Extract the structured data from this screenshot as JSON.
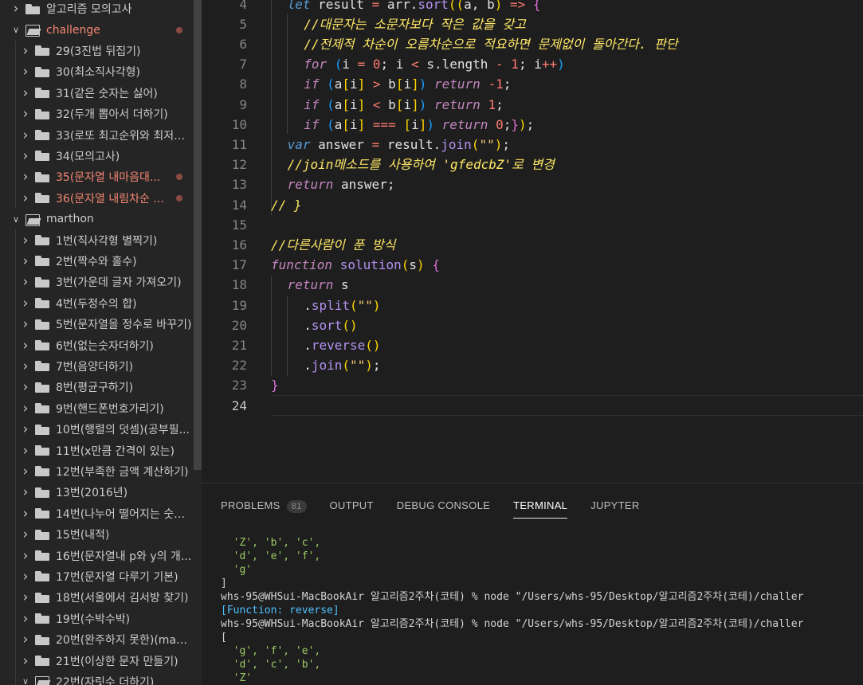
{
  "sidebar": {
    "rows": [
      {
        "label": "알고리즘 모의고사",
        "open": false,
        "depth": 0,
        "modified": false
      },
      {
        "label": "challenge",
        "open": true,
        "depth": 0,
        "modified": true
      },
      {
        "label": "29(3진법 뒤집기)",
        "open": false,
        "depth": 1,
        "modified": false
      },
      {
        "label": "30(최소직사각형)",
        "open": false,
        "depth": 1,
        "modified": false
      },
      {
        "label": "31(같은 숫자는 싫어)",
        "open": false,
        "depth": 1,
        "modified": false
      },
      {
        "label": "32(두개 뽑아서 더하기)",
        "open": false,
        "depth": 1,
        "modified": false
      },
      {
        "label": "33(로또 최고순위와 최저순...",
        "open": false,
        "depth": 1,
        "modified": false
      },
      {
        "label": "34(모의고사)",
        "open": false,
        "depth": 1,
        "modified": false
      },
      {
        "label": "35(문자열 내마음대...",
        "open": false,
        "depth": 1,
        "modified": true
      },
      {
        "label": "36(문자열 내림차순 ...",
        "open": false,
        "depth": 1,
        "modified": true
      },
      {
        "label": "marthon",
        "open": true,
        "depth": 0,
        "modified": false
      },
      {
        "label": "1번(직사각형 별찍기)",
        "open": false,
        "depth": 1,
        "modified": false
      },
      {
        "label": "2번(짝수와 홀수)",
        "open": false,
        "depth": 1,
        "modified": false
      },
      {
        "label": "3번(가운데 글자 가져오기)",
        "open": false,
        "depth": 1,
        "modified": false
      },
      {
        "label": "4번(두정수의 합)",
        "open": false,
        "depth": 1,
        "modified": false
      },
      {
        "label": "5번(문자열을 정수로 바꾸기)",
        "open": false,
        "depth": 1,
        "modified": false
      },
      {
        "label": "6번(없는숫자더하기)",
        "open": false,
        "depth": 1,
        "modified": false
      },
      {
        "label": "7번(음양더하기)",
        "open": false,
        "depth": 1,
        "modified": false
      },
      {
        "label": "8번(평균구하기)",
        "open": false,
        "depth": 1,
        "modified": false
      },
      {
        "label": "9번(핸드폰번호가리기)",
        "open": false,
        "depth": 1,
        "modified": false
      },
      {
        "label": "10번(행렬의 덧셈)(공부필...",
        "open": false,
        "depth": 1,
        "modified": false
      },
      {
        "label": "11번(x만큼 간격이 있는)",
        "open": false,
        "depth": 1,
        "modified": false
      },
      {
        "label": "12번(부족한 금액 계산하기)",
        "open": false,
        "depth": 1,
        "modified": false
      },
      {
        "label": "13번(2016년)",
        "open": false,
        "depth": 1,
        "modified": false
      },
      {
        "label": "14번(나누어 떨어지는 숫자...",
        "open": false,
        "depth": 1,
        "modified": false
      },
      {
        "label": "15번(내적)",
        "open": false,
        "depth": 1,
        "modified": false
      },
      {
        "label": "16번(문자열내 p와 y의 개...",
        "open": false,
        "depth": 1,
        "modified": false
      },
      {
        "label": "17번(문자열 다루기 기본)",
        "open": false,
        "depth": 1,
        "modified": false
      },
      {
        "label": "18번(서울에서 김서방 찾기)",
        "open": false,
        "depth": 1,
        "modified": false
      },
      {
        "label": "19번(수박수박)",
        "open": false,
        "depth": 1,
        "modified": false
      },
      {
        "label": "20번(완주하지 못한)(map...",
        "open": false,
        "depth": 1,
        "modified": false
      },
      {
        "label": "21번(이상한 문자 만들기)",
        "open": false,
        "depth": 1,
        "modified": false
      },
      {
        "label": "22번(자릿수 더하기)",
        "open": true,
        "depth": 1,
        "modified": false
      }
    ]
  },
  "editor": {
    "active_line": 24,
    "lines": [
      {
        "n": "4",
        "tokens": [
          [
            "kwb",
            "let"
          ],
          [
            "var",
            " result "
          ],
          [
            "op",
            "="
          ],
          [
            "var",
            " arr."
          ],
          [
            "fn",
            "sort"
          ],
          [
            "br1",
            "(("
          ],
          [
            "var",
            "a, b"
          ],
          [
            "br1",
            ")"
          ],
          [
            "op",
            " =>"
          ],
          [
            "br2",
            " {"
          ]
        ],
        "indent": 1
      },
      {
        "n": "5",
        "tokens": [
          [
            "cmt",
            "//대문자는 소문자보다 작은 값을 갖고"
          ]
        ],
        "indent": 2
      },
      {
        "n": "6",
        "tokens": [
          [
            "cmt",
            "//전제적 차순이 오름차순으로 적요하면 문제없이 돌아간다. 판단"
          ]
        ],
        "indent": 2
      },
      {
        "n": "7",
        "tokens": [
          [
            "kw",
            "for"
          ],
          [
            "br3",
            " ("
          ],
          [
            "var",
            "i "
          ],
          [
            "op",
            "="
          ],
          [
            "num",
            " 0"
          ],
          [
            "var",
            "; i "
          ],
          [
            "op",
            "<"
          ],
          [
            "var",
            " s.length "
          ],
          [
            "op",
            "-"
          ],
          [
            "num",
            " 1"
          ],
          [
            "var",
            "; i"
          ],
          [
            "op",
            "++"
          ],
          [
            "br3",
            ")"
          ]
        ],
        "indent": 2
      },
      {
        "n": "8",
        "tokens": [
          [
            "kw",
            "if"
          ],
          [
            "br3",
            " ("
          ],
          [
            "var",
            "a"
          ],
          [
            "br1",
            "["
          ],
          [
            "var",
            "i"
          ],
          [
            "br1",
            "]"
          ],
          [
            "op",
            " >"
          ],
          [
            "var",
            " b"
          ],
          [
            "br1",
            "["
          ],
          [
            "var",
            "i"
          ],
          [
            "br1",
            "]"
          ],
          [
            "br3",
            ")"
          ],
          [
            "ret",
            " return"
          ],
          [
            "num",
            " -1"
          ],
          [
            "var",
            ";"
          ]
        ],
        "indent": 2
      },
      {
        "n": "9",
        "tokens": [
          [
            "kw",
            "if"
          ],
          [
            "br3",
            " ("
          ],
          [
            "var",
            "a"
          ],
          [
            "br1",
            "["
          ],
          [
            "var",
            "i"
          ],
          [
            "br1",
            "]"
          ],
          [
            "op",
            " <"
          ],
          [
            "var",
            " b"
          ],
          [
            "br1",
            "["
          ],
          [
            "var",
            "i"
          ],
          [
            "br1",
            "]"
          ],
          [
            "br3",
            ")"
          ],
          [
            "ret",
            " return"
          ],
          [
            "num",
            " 1"
          ],
          [
            "var",
            ";"
          ]
        ],
        "indent": 2
      },
      {
        "n": "10",
        "tokens": [
          [
            "kw",
            "if"
          ],
          [
            "br3",
            " ("
          ],
          [
            "var",
            "a"
          ],
          [
            "br1",
            "["
          ],
          [
            "var",
            "i"
          ],
          [
            "br1",
            "]"
          ],
          [
            "op",
            " ==="
          ],
          [
            "br1",
            " ["
          ],
          [
            "var",
            "i"
          ],
          [
            "br1",
            "]"
          ],
          [
            "br3",
            ")"
          ],
          [
            "ret",
            " return"
          ],
          [
            "num",
            " 0"
          ],
          [
            "var",
            ";"
          ],
          [
            "br2",
            "}"
          ],
          [
            "br1",
            ")"
          ],
          [
            "var",
            ";"
          ]
        ],
        "indent": 2
      },
      {
        "n": "11",
        "tokens": [
          [
            "kwb",
            "var"
          ],
          [
            "var",
            " answer "
          ],
          [
            "op",
            "="
          ],
          [
            "var",
            " result."
          ],
          [
            "fn",
            "join"
          ],
          [
            "br1",
            "("
          ],
          [
            "str",
            "\"\""
          ],
          [
            "br1",
            ")"
          ],
          [
            "var",
            ";"
          ]
        ],
        "indent": 1
      },
      {
        "n": "12",
        "tokens": [
          [
            "cmt",
            "//join메소드를 사용하여 'gfedcbZ'로 변경"
          ]
        ],
        "indent": 1
      },
      {
        "n": "13",
        "tokens": [
          [
            "ret",
            "return"
          ],
          [
            "var",
            " answer;"
          ]
        ],
        "indent": 1
      },
      {
        "n": "14",
        "tokens": [
          [
            "cmt",
            "// }"
          ]
        ],
        "indent": 0
      },
      {
        "n": "15",
        "tokens": [],
        "indent": 0
      },
      {
        "n": "16",
        "tokens": [
          [
            "cmt",
            "//다른사람이 푼 방식"
          ]
        ],
        "indent": 0
      },
      {
        "n": "17",
        "tokens": [
          [
            "kw",
            "function"
          ],
          [
            "fn",
            " solution"
          ],
          [
            "br1",
            "("
          ],
          [
            "var",
            "s"
          ],
          [
            "br1",
            ")"
          ],
          [
            "br2",
            " {"
          ]
        ],
        "indent": 0
      },
      {
        "n": "18",
        "tokens": [
          [
            "ret",
            "return"
          ],
          [
            "var",
            " s"
          ]
        ],
        "indent": 1
      },
      {
        "n": "19",
        "tokens": [
          [
            "var",
            "."
          ],
          [
            "fn",
            "split"
          ],
          [
            "br1",
            "("
          ],
          [
            "str",
            "\"\""
          ],
          [
            "br1",
            ")"
          ]
        ],
        "indent": 2
      },
      {
        "n": "20",
        "tokens": [
          [
            "var",
            "."
          ],
          [
            "fn",
            "sort"
          ],
          [
            "br1",
            "()"
          ]
        ],
        "indent": 2
      },
      {
        "n": "21",
        "tokens": [
          [
            "var",
            "."
          ],
          [
            "fn",
            "reverse"
          ],
          [
            "br1",
            "()"
          ]
        ],
        "indent": 2
      },
      {
        "n": "22",
        "tokens": [
          [
            "var",
            "."
          ],
          [
            "fn",
            "join"
          ],
          [
            "br1",
            "("
          ],
          [
            "str",
            "\"\""
          ],
          [
            "br1",
            ")"
          ],
          [
            "var",
            ";"
          ]
        ],
        "indent": 2
      },
      {
        "n": "23",
        "tokens": [
          [
            "br2",
            "}"
          ]
        ],
        "indent": 0
      },
      {
        "n": "24",
        "tokens": [],
        "indent": 0
      }
    ]
  },
  "panel": {
    "tabs": [
      {
        "label": "PROBLEMS",
        "badge": "81",
        "active": false
      },
      {
        "label": "OUTPUT",
        "badge": null,
        "active": false
      },
      {
        "label": "DEBUG CONSOLE",
        "badge": null,
        "active": false
      },
      {
        "label": "TERMINAL",
        "badge": null,
        "active": true
      },
      {
        "label": "JUPYTER",
        "badge": null,
        "active": false
      }
    ],
    "terminal_lines": [
      {
        "text": "  'Z', 'b', 'c',",
        "kind": "str"
      },
      {
        "text": "  'd', 'e', 'f',",
        "kind": "str"
      },
      {
        "text": "  'g'",
        "kind": "str"
      },
      {
        "text": "]",
        "kind": "plain"
      },
      {
        "text": "whs-95@WHSui-MacBookAir 알고리즘2주차(코테) % node \"/Users/whs-95/Desktop/알고리즘2주차(코테)/challer",
        "kind": "plain"
      },
      {
        "text": "[Function: reverse]",
        "kind": "fn"
      },
      {
        "text": "whs-95@WHSui-MacBookAir 알고리즘2주차(코테) % node \"/Users/whs-95/Desktop/알고리즘2주차(코테)/challer",
        "kind": "plain"
      },
      {
        "text": "[",
        "kind": "plain"
      },
      {
        "text": "  'g', 'f', 'e',",
        "kind": "str"
      },
      {
        "text": "  'd', 'c', 'b',",
        "kind": "str"
      },
      {
        "text": "  'Z'",
        "kind": "str"
      }
    ]
  }
}
